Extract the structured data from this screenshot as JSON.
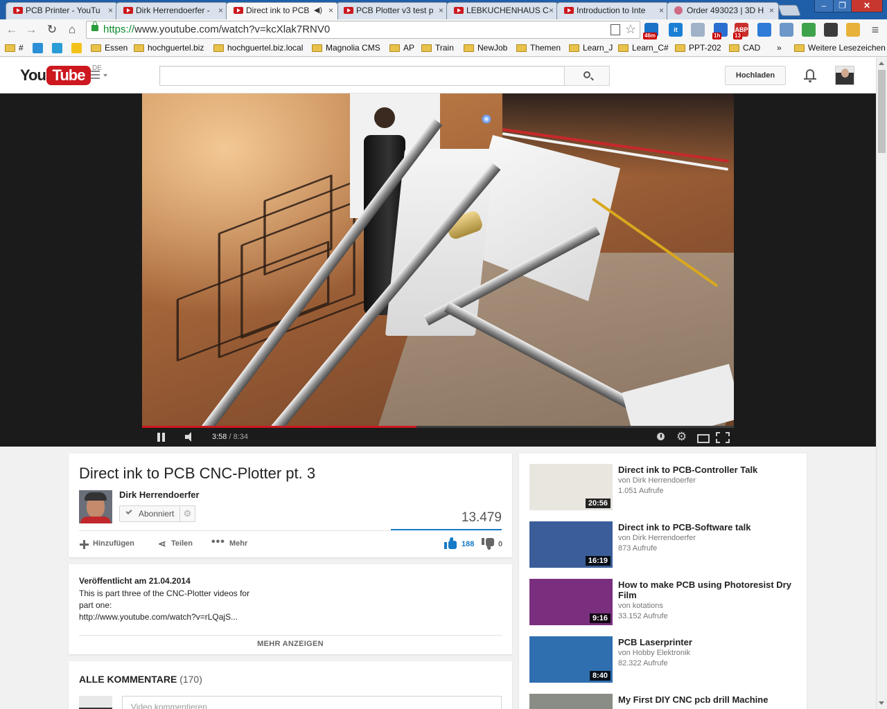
{
  "browser": {
    "tabs": [
      {
        "title": "PCB Printer - YouTu",
        "favicon": "youtube-icon",
        "active": false
      },
      {
        "title": "Dirk Herrendoerfer -",
        "favicon": "youtube-icon",
        "active": false
      },
      {
        "title": "Direct ink to PCB",
        "favicon": "youtube-icon",
        "active": true
      },
      {
        "title": "PCB Plotter v3 test p",
        "favicon": "youtube-icon",
        "active": false
      },
      {
        "title": "LEBKUCHENHAUS C",
        "favicon": "youtube-icon",
        "active": false
      },
      {
        "title": "Introduction to Inte",
        "favicon": "youtube-icon",
        "active": false
      },
      {
        "title": "Order 493023 | 3D H",
        "favicon": "shop-icon",
        "active": false
      }
    ],
    "tab_close": "×",
    "url_scheme": "https://",
    "url_rest": "www.youtube.com/watch?v=kcXlak7RNV0",
    "extensions": [
      {
        "name": "calendar-46m",
        "badge": "46m",
        "color": "#1a73c6"
      },
      {
        "name": "it",
        "label": "it",
        "color": "#1c7fd6"
      },
      {
        "name": "notes",
        "label": "",
        "color": "#9fb2c8"
      },
      {
        "name": "calendar-1h",
        "badge": "1h",
        "color": "#2a6fd0"
      },
      {
        "name": "adblock-plus",
        "label": "ABP",
        "badge": "13",
        "color": "#c7302b"
      },
      {
        "name": "window",
        "label": "",
        "color": "#2f7bd8"
      },
      {
        "name": "camera",
        "label": "",
        "color": "#6c97c8"
      },
      {
        "name": "evernote",
        "label": "",
        "color": "#3fa34b"
      },
      {
        "name": "tower",
        "label": "",
        "color": "#3c3c3c"
      },
      {
        "name": "drive",
        "label": "",
        "color": "#e8b23a"
      },
      {
        "name": "menu",
        "label": "≡",
        "color": "#7a7a7a"
      }
    ],
    "bookmarks": [
      {
        "label": "#",
        "type": "folder"
      },
      {
        "label": "",
        "type": "site",
        "color": "#2a8fd6"
      },
      {
        "label": "",
        "type": "site",
        "color": "#2a9dd6"
      },
      {
        "label": "",
        "type": "site",
        "color": "#f3c21a"
      },
      {
        "label": "Essen",
        "type": "folder"
      },
      {
        "label": "hochguertel.biz",
        "type": "folder"
      },
      {
        "label": "hochguertel.biz.local",
        "type": "folder"
      },
      {
        "label": "Magnolia CMS",
        "type": "folder"
      },
      {
        "label": "AP",
        "type": "folder"
      },
      {
        "label": "Train",
        "type": "folder"
      },
      {
        "label": "NewJob",
        "type": "folder"
      },
      {
        "label": "Themen",
        "type": "folder"
      },
      {
        "label": "Learn_J",
        "type": "folder"
      },
      {
        "label": "Learn_C#",
        "type": "folder"
      },
      {
        "label": "PPT-202",
        "type": "folder"
      },
      {
        "label": "CAD",
        "type": "folder"
      }
    ],
    "bookmarks_overflow": "»",
    "other_bookmarks": "Weitere Lesezeichen"
  },
  "youtube": {
    "logo_you": "You",
    "logo_tube": "Tube",
    "country": "DE",
    "search_placeholder": "",
    "upload_label": "Hochladen"
  },
  "player": {
    "current_time": "3:58",
    "separator": " / ",
    "duration": "8:34",
    "progress_fraction": 0.464,
    "loaded_fraction": 0.464
  },
  "video": {
    "title": "Direct ink to PCB CNC-Plotter pt. 3",
    "owner": "Dirk Herrendoerfer",
    "subscribe_label": "Abonniert",
    "views": "13.479",
    "likes": "188",
    "dislikes": "0",
    "like_ratio": 1.0,
    "actions": {
      "add": "Hinzufügen",
      "share": "Teilen",
      "more": "Mehr"
    }
  },
  "description": {
    "published": "Veröffentlicht am 21.04.2014",
    "lines": [
      "This is part three of the CNC-Plotter videos for",
      "part one:",
      "http://www.youtube.com/watch?v=rLQajS..."
    ],
    "more_label": "MEHR ANZEIGEN"
  },
  "comments": {
    "title": "ALLE KOMMENTARE",
    "count": "(170)",
    "input_placeholder": "Video kommentieren"
  },
  "related": [
    {
      "title": "Direct ink to PCB-Controller Talk",
      "channel": "von Dirk Herrendoerfer",
      "views": "1.051 Aufrufe",
      "duration": "20:56",
      "thumb_bg": "#e9e6e0"
    },
    {
      "title": "Direct ink to PCB-Software talk",
      "channel": "von Dirk Herrendoerfer",
      "views": "873 Aufrufe",
      "duration": "16:19",
      "thumb_bg": "#3b5e9a"
    },
    {
      "title": "How to make PCB using Photoresist Dry Film",
      "channel": "von kotations",
      "views": "33.152 Aufrufe",
      "duration": "9:16",
      "thumb_bg": "#7a2f7e"
    },
    {
      "title": "PCB Laserprinter",
      "channel": "von Hobby Elektronik",
      "views": "82.322 Aufrufe",
      "duration": "8:40",
      "thumb_bg": "#2f6fb0"
    },
    {
      "title": "My First DIY CNC pcb drill Machine",
      "channel": "",
      "views": "",
      "duration": "",
      "thumb_bg": "#8a8c86"
    }
  ]
}
